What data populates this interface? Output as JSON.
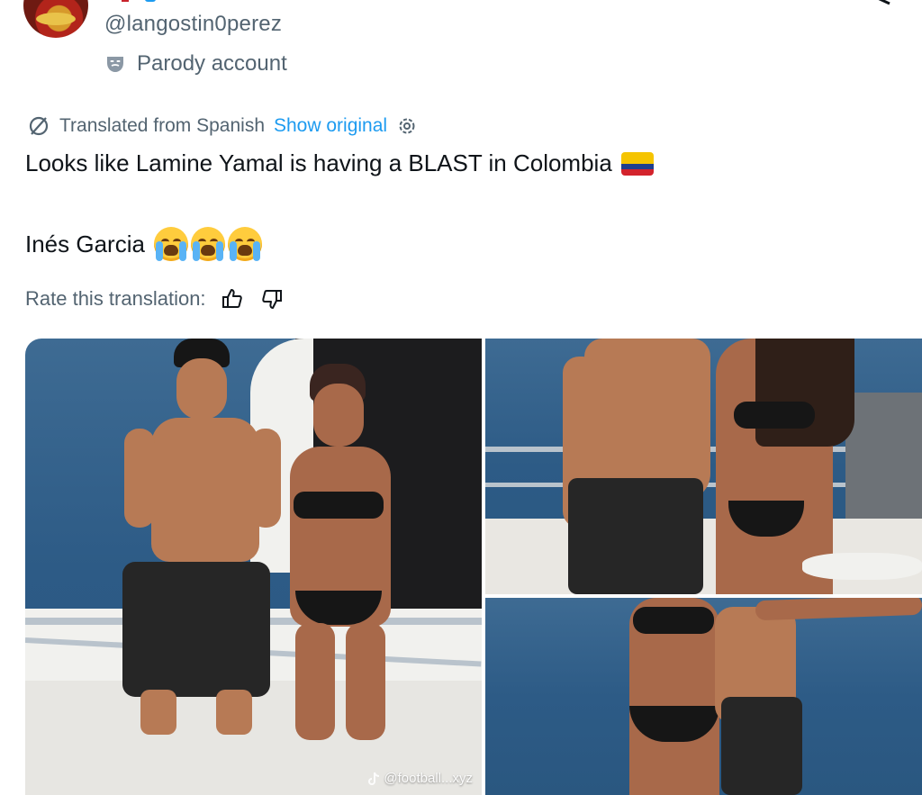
{
  "header": {
    "handle": "@langostin0perez",
    "parody_label": "Parody account"
  },
  "translation": {
    "label": "Translated from Spanish",
    "show_original": "Show original"
  },
  "tweet": {
    "line1": "Looks like Lamine Yamal is having a BLAST in Colombia",
    "line2": "Inés Garcia"
  },
  "rating": {
    "prompt": "Rate this translation:"
  },
  "media": {
    "watermark": "@football...xyz",
    "photo_count": 3
  },
  "icons": [
    "theater-mask-icon",
    "translate-icon",
    "gear-icon",
    "thumbs-up-icon",
    "thumbs-down-icon",
    "colombia-flag-icon",
    "loudly-crying-face-icon",
    "tiktok-icon"
  ],
  "colors": {
    "link": "#1d9bf0",
    "secondary_text": "#536471",
    "primary_text": "#0f1419",
    "sea": "#2d5b86"
  }
}
